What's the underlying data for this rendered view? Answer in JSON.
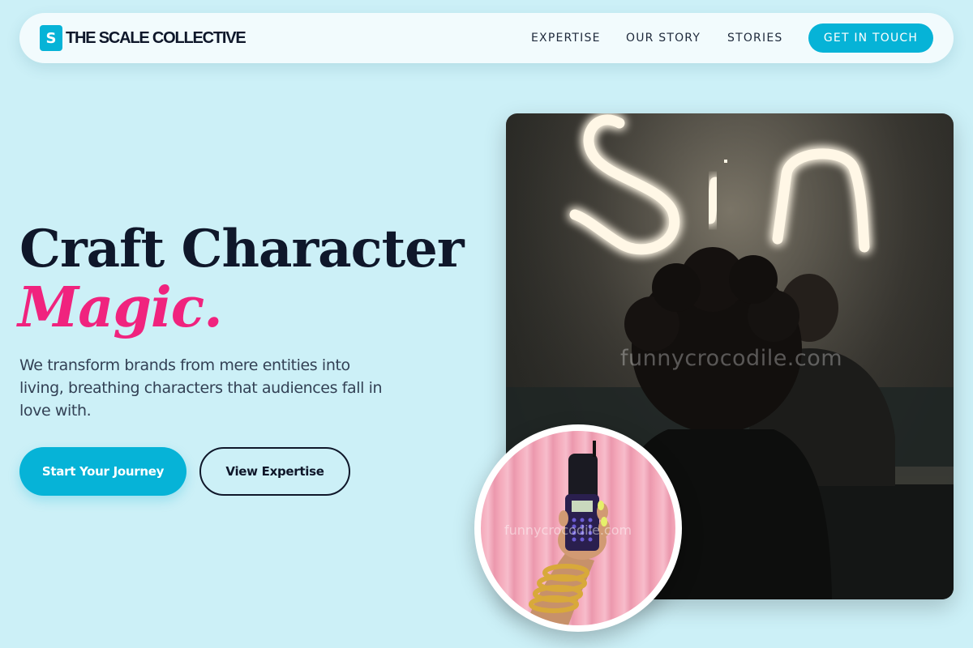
{
  "brand": {
    "logo_letter": "S",
    "name": "THE SCALE COLLECTIVE",
    "accent_color": "#06b3d7",
    "highlight_color": "#f0237e",
    "background_color": "#ccf0f7"
  },
  "nav": {
    "links": [
      {
        "label": "EXPERTISE"
      },
      {
        "label": "OUR STORY"
      },
      {
        "label": "STORIES"
      }
    ],
    "cta_label": "GET IN TOUCH"
  },
  "hero": {
    "title": "Craft Character",
    "title_accent": "Magic.",
    "description": "We transform brands from mere entities into living, breathing characters that audiences fall in love with.",
    "primary_button": "Start Your Journey",
    "secondary_button": "View Expertise"
  },
  "images": {
    "main_sign_text": "Sin",
    "watermark": "funnycrocodile.com"
  }
}
